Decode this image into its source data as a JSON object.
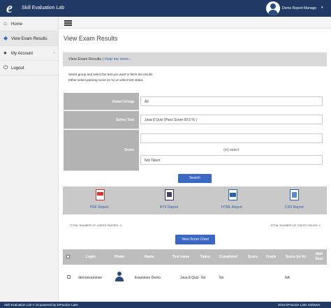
{
  "header": {
    "logo_letter": "e",
    "app_title": "Skill Evaluation Lab",
    "user_label": "Demo Report Manage",
    "user_caret": "▾"
  },
  "sidebar": {
    "items": [
      {
        "label": "Home",
        "icon": "home-icon",
        "glyph": "⌂"
      },
      {
        "label": "View Exam Results",
        "icon": "diamond-icon",
        "glyph": "◆"
      },
      {
        "label": "My Account",
        "icon": "user-icon",
        "glyph": "●",
        "chevron": "‹"
      },
      {
        "label": "Logout",
        "icon": "power-icon",
        "glyph": "⏻"
      }
    ]
  },
  "page": {
    "title": "View Exam Results",
    "panel_title": "View Exam Results",
    "panel_sep": " | ",
    "help_link": "Help me more...",
    "instruction_1": "Select group and select the test you want to fetch the results.",
    "instruction_2": "Either select passing score (in %) or select test status"
  },
  "form": {
    "group_label": "Select Group",
    "group_value": "All",
    "test_label": "Select Test",
    "test_value": "Java 8 Quiz (Pass Score 60.0 % )",
    "score_label": "Score",
    "score_value": "",
    "or_select": "(or) select",
    "status_value": "Not Taken",
    "search_button": "Search"
  },
  "reports": [
    {
      "label": "PDF Report",
      "icon": "pdf-file-icon"
    },
    {
      "label": "RTF Report",
      "icon": "rtf-file-icon"
    },
    {
      "label": "HTML Report",
      "icon": "html-file-icon"
    },
    {
      "label": "CSV Report",
      "icon": "csv-file-icon"
    }
  ],
  "counts": {
    "passed": "TOTAL NUMBER OF USERS PASSED: 0",
    "failed": "TOTAL NUMBER OF USERS FAILED: 0"
  },
  "score_chart_button": "View Score Chart",
  "table": {
    "headers": [
      "Login",
      "Photo",
      "Name",
      "Test name",
      "Taken",
      "Completed",
      "Score",
      "Grade",
      "Score (in %)",
      "Mail Sent"
    ],
    "rows": [
      {
        "login": "demoexaminee",
        "name": "Examinee Demo",
        "test": "Java 8 Quiz",
        "taken": "No",
        "completed": "No",
        "score": "",
        "grade": "",
        "score_pct": "NA",
        "mail": ""
      }
    ]
  },
  "footer": {
    "left": "Skill Evaluation Lab V 10 powered by EPractize Labs",
    "right": "2016 EPractize Labs Software"
  },
  "colors": {
    "header_bg": "#203a63",
    "accent": "#3a68c4",
    "label_bg": "#b3b3b3"
  }
}
